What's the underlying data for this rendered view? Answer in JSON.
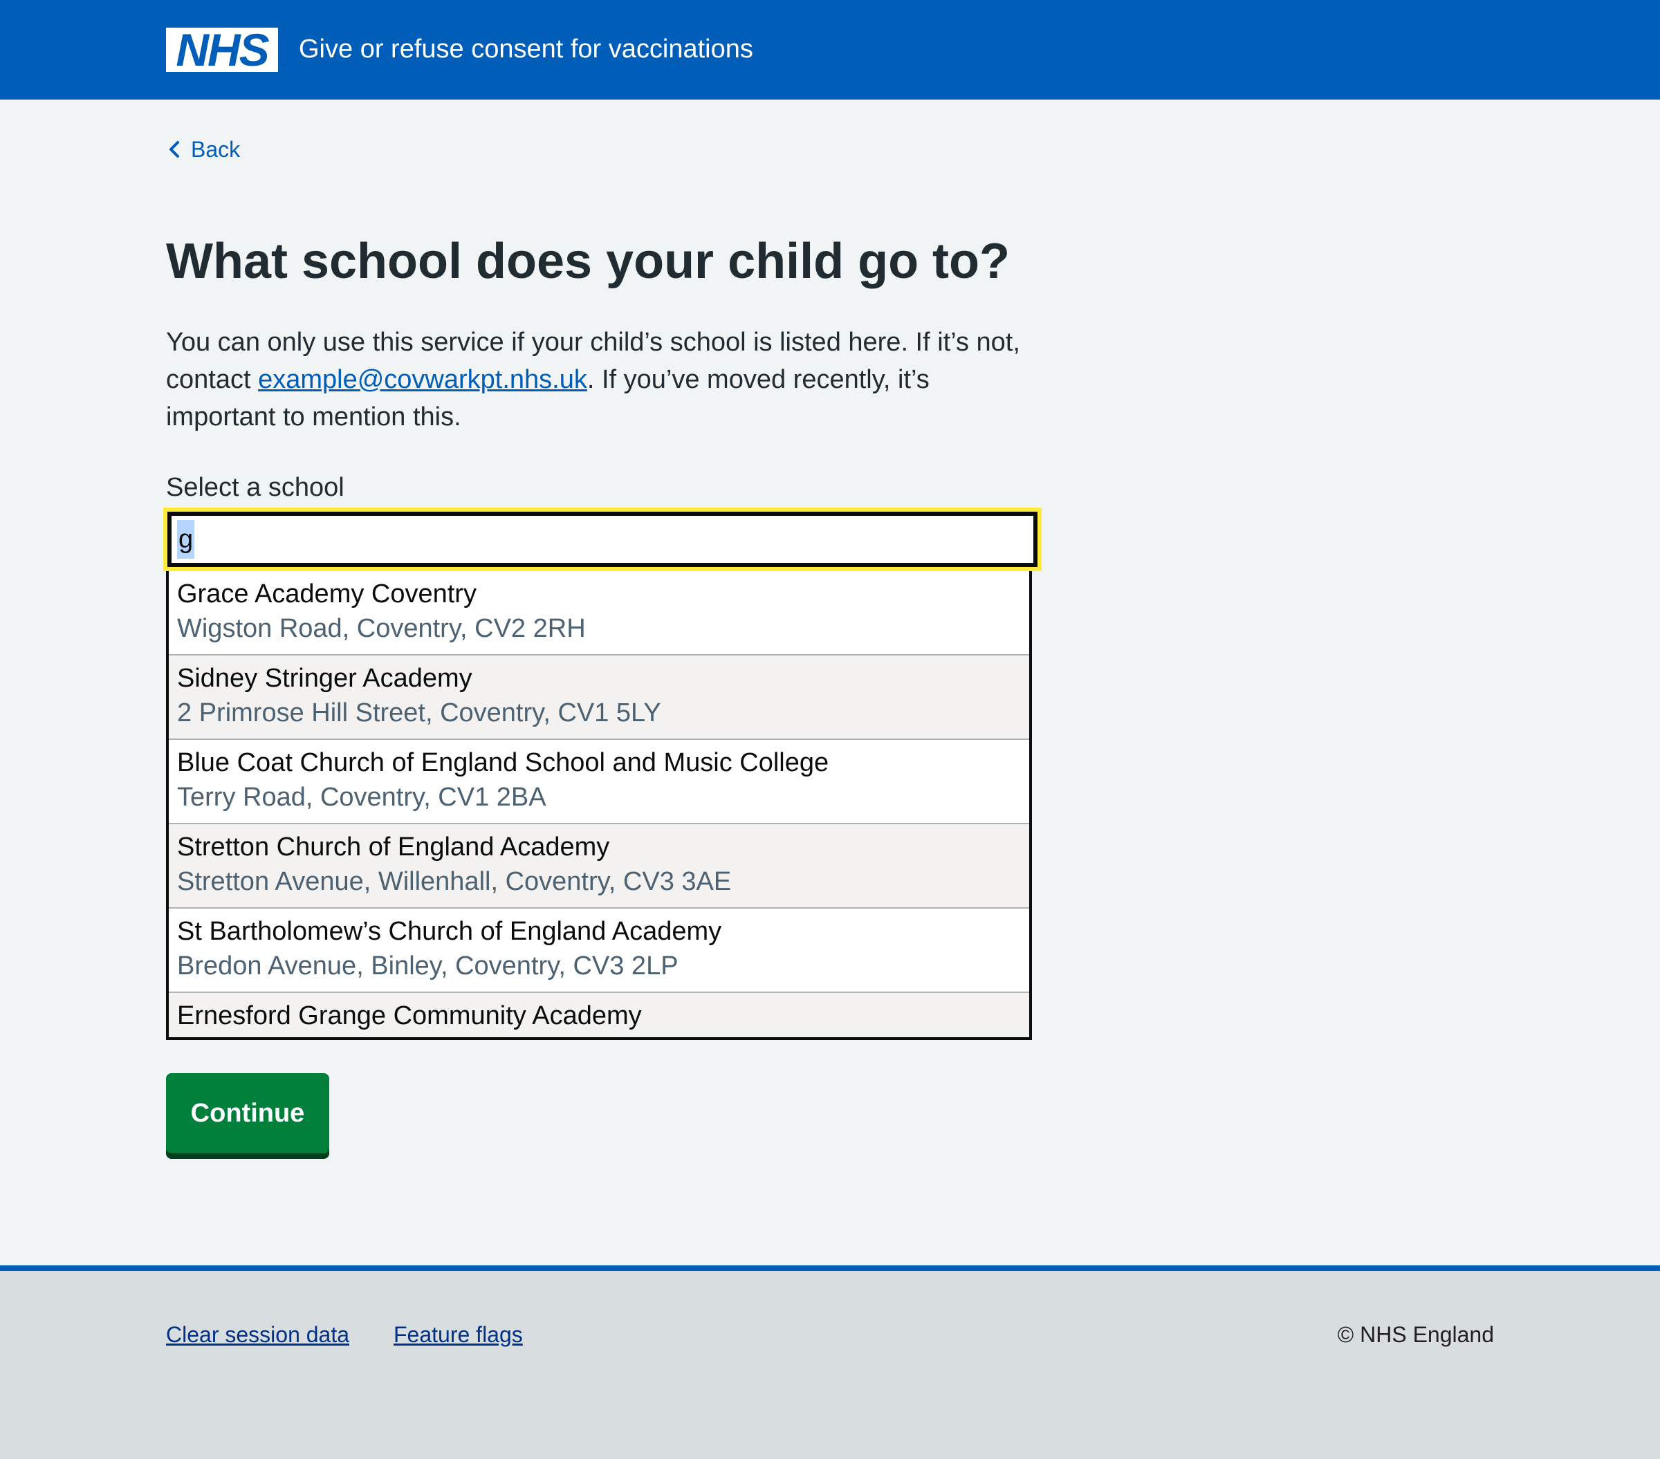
{
  "header": {
    "logo_text": "NHS",
    "service_name": "Give or refuse consent for vaccinations"
  },
  "back_link": {
    "label": "Back"
  },
  "page_title": "What school does your child go to?",
  "intro": {
    "before_link": "You can only use this service if your child’s school is listed here. If it’s not, contact ",
    "email": "example@covwarkpt.nhs.uk",
    "after_link": ". If you’ve moved recently, it’s important to mention this."
  },
  "school_field": {
    "label": "Select a school",
    "value": "g"
  },
  "options": [
    {
      "name": "Grace Academy Coventry",
      "address": "Wigston Road, Coventry, CV2 2RH"
    },
    {
      "name": "Sidney Stringer Academy",
      "address": "2 Primrose Hill Street, Coventry, CV1 5LY"
    },
    {
      "name": "Blue Coat Church of England School and Music College",
      "address": "Terry Road, Coventry, CV1 2BA"
    },
    {
      "name": "Stretton Church of England Academy",
      "address": "Stretton Avenue, Willenhall, Coventry, CV3 3AE"
    },
    {
      "name": "St Bartholomew’s Church of England Academy",
      "address": "Bredon Avenue, Binley, Coventry, CV3 2LP"
    },
    {
      "name": "Ernesford Grange Community Academy",
      "address": ""
    }
  ],
  "continue_label": "Continue",
  "footer": {
    "links": [
      "Clear session data",
      "Feature flags"
    ],
    "copyright": "© NHS England"
  },
  "colors": {
    "nhs_blue": "#005eb8",
    "focus_yellow": "#ffeb3b",
    "button_green": "#007f3b",
    "page_background": "#f0f4f5",
    "footer_background": "#d8dde0"
  }
}
